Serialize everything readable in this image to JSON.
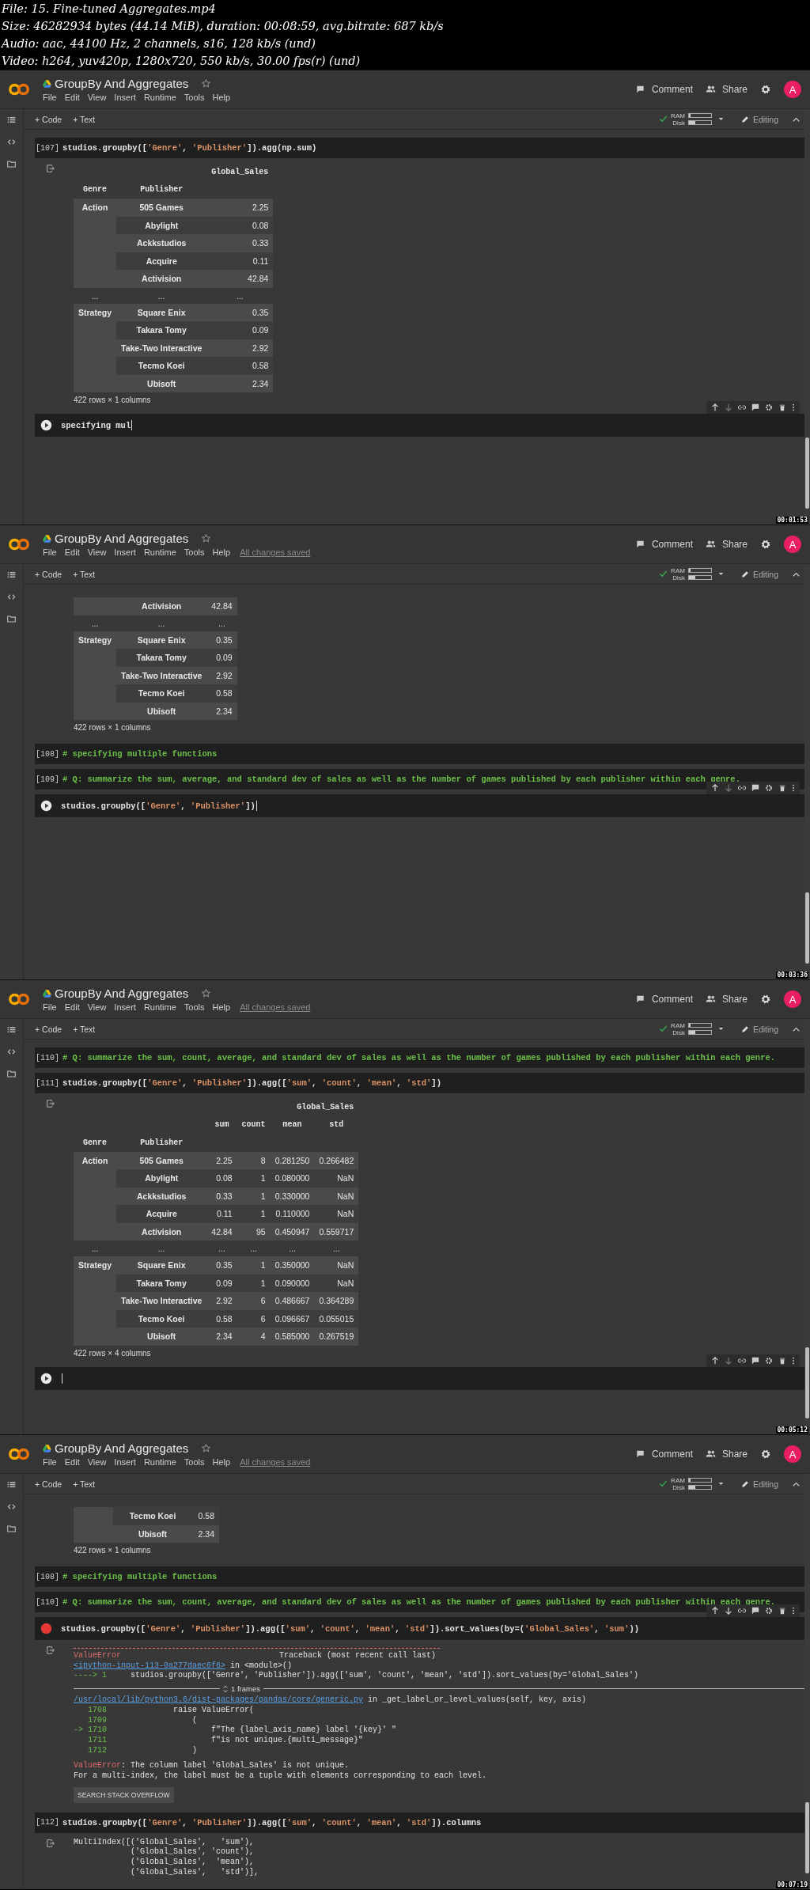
{
  "file_info": [
    "File: 15. Fine-tuned Aggregates.mp4",
    "Size: 46282934 bytes (44.14 MiB), duration: 00:08:59, avg.bitrate: 687 kb/s",
    "Audio: aac, 44100 Hz, 2 channels, s16, 128 kb/s (und)",
    "Video: h264, yuv420p, 1280x720, 550 kb/s, 30.00 fps(r) (und)"
  ],
  "frames": [
    {
      "title": "GroupBy And Aggregates",
      "menu": [
        "File",
        "Edit",
        "View",
        "Insert",
        "Runtime",
        "Tools",
        "Help"
      ],
      "comment": "Comment",
      "share": "Share",
      "avatar": "A",
      "add_code": "+ Code",
      "add_text": "+ Text",
      "ram": "RAM",
      "disk": "Disk",
      "mode": "Editing",
      "timestamp": "00:01:53",
      "cells": [
        {
          "kind": "code",
          "prompt": "[107]",
          "source": "studios.groupby(['Genre', 'Publisher']).agg(np.sum)",
          "output": {
            "kind": "table",
            "column_header": "Global_Sales",
            "index_names": [
              "Genre",
              "Publisher"
            ],
            "groups": [
              {
                "genre": "Action",
                "rows": [
                  {
                    "publisher": "505 Games",
                    "values": [
                      "2.25"
                    ]
                  },
                  {
                    "publisher": "Abylight",
                    "values": [
                      "0.08"
                    ]
                  },
                  {
                    "publisher": "Ackkstudios",
                    "values": [
                      "0.33"
                    ]
                  },
                  {
                    "publisher": "Acquire",
                    "values": [
                      "0.11"
                    ]
                  },
                  {
                    "publisher": "Activision",
                    "values": [
                      "42.84"
                    ]
                  }
                ]
              },
              {
                "ellipsis": [
                  "...",
                  "...",
                  "..."
                ]
              },
              {
                "genre": "Strategy",
                "rows": [
                  {
                    "publisher": "Square Enix",
                    "values": [
                      "0.35"
                    ]
                  },
                  {
                    "publisher": "Takara Tomy",
                    "values": [
                      "0.09"
                    ]
                  },
                  {
                    "publisher": "Take-Two Interactive",
                    "values": [
                      "2.92"
                    ]
                  },
                  {
                    "publisher": "Tecmo Koei",
                    "values": [
                      "0.58"
                    ]
                  },
                  {
                    "publisher": "Ubisoft",
                    "values": [
                      "2.34"
                    ]
                  }
                ]
              }
            ],
            "footer": "422 rows × 1 columns"
          }
        },
        {
          "kind": "active",
          "error": false,
          "source": "specifying mul"
        }
      ]
    },
    {
      "title": "GroupBy And Aggregates",
      "menu": [
        "File",
        "Edit",
        "View",
        "Insert",
        "Runtime",
        "Tools",
        "Help"
      ],
      "save_status": "All changes saved",
      "comment": "Comment",
      "share": "Share",
      "avatar": "A",
      "add_code": "+ Code",
      "add_text": "+ Text",
      "ram": "RAM",
      "disk": "Disk",
      "mode": "Editing",
      "timestamp": "00:03:36",
      "cells": [
        {
          "kind": "output",
          "output": {
            "kind": "table",
            "groups": [
              {
                "rows": [
                  {
                    "publisher": "Activision",
                    "values": [
                      "42.84"
                    ]
                  }
                ]
              },
              {
                "ellipsis": [
                  "...",
                  "...",
                  "..."
                ]
              },
              {
                "genre": "Strategy",
                "rows": [
                  {
                    "publisher": "Square Enix",
                    "values": [
                      "0.35"
                    ]
                  },
                  {
                    "publisher": "Takara Tomy",
                    "values": [
                      "0.09"
                    ]
                  },
                  {
                    "publisher": "Take-Two Interactive",
                    "values": [
                      "2.92"
                    ]
                  },
                  {
                    "publisher": "Tecmo Koei",
                    "values": [
                      "0.58"
                    ]
                  },
                  {
                    "publisher": "Ubisoft",
                    "values": [
                      "2.34"
                    ]
                  }
                ]
              }
            ],
            "footer": "422 rows × 1 columns"
          }
        },
        {
          "kind": "comment",
          "prompt": "[108]",
          "source": "# specifying multiple functions"
        },
        {
          "kind": "comment",
          "prompt": "[109]",
          "source": "# Q: summarize the sum, average, and standard dev of sales as well as the number of games published by each publisher within each genre."
        },
        {
          "kind": "active",
          "error": false,
          "source": "studios.groupby(['Genre', 'Publisher'])"
        }
      ]
    },
    {
      "title": "GroupBy And Aggregates",
      "menu": [
        "File",
        "Edit",
        "View",
        "Insert",
        "Runtime",
        "Tools",
        "Help"
      ],
      "save_status": "All changes saved",
      "comment": "Comment",
      "share": "Share",
      "avatar": "A",
      "add_code": "+ Code",
      "add_text": "+ Text",
      "ram": "RAM",
      "disk": "Disk",
      "mode": "Editing",
      "timestamp": "00:05:12",
      "cells": [
        {
          "kind": "comment",
          "prompt": "[110]",
          "source": "# Q: summarize the sum, count, average, and standard dev of sales as well as the number of games published by each publisher within each genre."
        },
        {
          "kind": "code",
          "prompt": "[111]",
          "source": "studios.groupby(['Genre', 'Publisher']).agg(['sum', 'count', 'mean', 'std'])",
          "output": {
            "kind": "table",
            "column_header": "Global_Sales",
            "subcolumns": [
              "sum",
              "count",
              "mean",
              "std"
            ],
            "index_names": [
              "Genre",
              "Publisher"
            ],
            "groups": [
              {
                "genre": "Action",
                "rows": [
                  {
                    "publisher": "505 Games",
                    "values": [
                      "2.25",
                      "8",
                      "0.281250",
                      "0.266482"
                    ]
                  },
                  {
                    "publisher": "Abylight",
                    "values": [
                      "0.08",
                      "1",
                      "0.080000",
                      "NaN"
                    ]
                  },
                  {
                    "publisher": "Ackkstudios",
                    "values": [
                      "0.33",
                      "1",
                      "0.330000",
                      "NaN"
                    ]
                  },
                  {
                    "publisher": "Acquire",
                    "values": [
                      "0.11",
                      "1",
                      "0.110000",
                      "NaN"
                    ]
                  },
                  {
                    "publisher": "Activision",
                    "values": [
                      "42.84",
                      "95",
                      "0.450947",
                      "0.559717"
                    ]
                  }
                ]
              },
              {
                "ellipsis": [
                  "...",
                  "...",
                  "...",
                  "...",
                  "...",
                  "..."
                ]
              },
              {
                "genre": "Strategy",
                "rows": [
                  {
                    "publisher": "Square Enix",
                    "values": [
                      "0.35",
                      "1",
                      "0.350000",
                      "NaN"
                    ]
                  },
                  {
                    "publisher": "Takara Tomy",
                    "values": [
                      "0.09",
                      "1",
                      "0.090000",
                      "NaN"
                    ]
                  },
                  {
                    "publisher": "Take-Two Interactive",
                    "values": [
                      "2.92",
                      "6",
                      "0.486667",
                      "0.364289"
                    ]
                  },
                  {
                    "publisher": "Tecmo Koei",
                    "values": [
                      "0.58",
                      "6",
                      "0.096667",
                      "0.055015"
                    ]
                  },
                  {
                    "publisher": "Ubisoft",
                    "values": [
                      "2.34",
                      "4",
                      "0.585000",
                      "0.267519"
                    ]
                  }
                ]
              }
            ],
            "footer": "422 rows × 4 columns"
          }
        },
        {
          "kind": "active",
          "error": false
        }
      ]
    },
    {
      "title": "GroupBy And Aggregates",
      "menu": [
        "File",
        "Edit",
        "View",
        "Insert",
        "Runtime",
        "Tools",
        "Help"
      ],
      "save_status": "All changes saved",
      "comment": "Comment",
      "share": "Share",
      "avatar": "A",
      "add_code": "+ Code",
      "add_text": "+ Text",
      "ram": "RAM",
      "disk": "Disk",
      "mode": "Editing",
      "timestamp": "00:07:19",
      "cells": [
        {
          "kind": "output",
          "output": {
            "kind": "table",
            "groups": [
              {
                "rows": [
                  {
                    "publisher": "Tecmo Koei",
                    "values": [
                      "0.58"
                    ]
                  },
                  {
                    "publisher": "Ubisoft",
                    "values": [
                      "2.34"
                    ]
                  }
                ]
              }
            ],
            "footer": "422 rows × 1 columns"
          }
        },
        {
          "kind": "comment",
          "prompt": "[108]",
          "source": "# specifying multiple functions"
        },
        {
          "kind": "comment",
          "prompt": "[110]",
          "source": "# Q: summarize the sum, count, average, and standard dev of sales as well as the number of games published by each publisher within each genre."
        },
        {
          "kind": "active",
          "error": true,
          "source": "studios.groupby(['Genre', 'Publisher']).agg(['sum', 'count', 'mean', 'std']).sort_values(by=('Global_Sales', 'sum'))",
          "output": {
            "kind": "traceback",
            "lines": [
              {
                "kind": "rule"
              },
              {
                "kind": "heading",
                "error": "ValueError",
                "text": "Traceback (most recent call last)"
              },
              {
                "kind": "location",
                "link": "<ipython-input-113-0a277daec6f6>",
                "text": " in <module>()"
              },
              {
                "kind": "source",
                "marker": "---->",
                "number": "1",
                "code": " studios.groupby(['Genre', 'Publisher']).agg(['sum', 'count', 'mean', 'std']).sort_values(by='Global_Sales')"
              },
              {
                "kind": "frames",
                "text": "1 frames"
              },
              {
                "kind": "location",
                "link": "/usr/local/lib/python3.6/dist-packages/pandas/core/generic.py",
                "text": " in _get_label_or_level_values(self, key, axis)"
              },
              {
                "kind": "source",
                "number": "1708",
                "code": "             raise ValueError("
              },
              {
                "kind": "source",
                "number": "1709",
                "code": "                 ("
              },
              {
                "kind": "source",
                "marker": "->",
                "number": "1710",
                "code": "                     f\"The {label_axis_name} label '{key}' \""
              },
              {
                "kind": "source",
                "number": "1711",
                "code": "                     f\"is not unique.{multi_message}\""
              },
              {
                "kind": "source",
                "number": "1712",
                "code": "                 )"
              },
              {
                "kind": "message",
                "error": "ValueError",
                "text": ": The column label 'Global_Sales' is not unique."
              },
              {
                "kind": "plain",
                "text": "For a multi-index, the label must be a tuple with elements corresponding to each level."
              },
              {
                "kind": "button",
                "text": "SEARCH STACK OVERFLOW"
              }
            ]
          }
        },
        {
          "kind": "code",
          "prompt": "[112]",
          "source": "studios.groupby(['Genre', 'Publisher']).agg(['sum', 'count', 'mean', 'std']).columns",
          "output": {
            "kind": "text",
            "lines": [
              "MultiIndex([('Global_Sales',   'sum'),",
              "            ('Global_Sales', 'count'),",
              "            ('Global_Sales',  'mean'),",
              "            ('Global_Sales',   'std')],"
            ]
          }
        }
      ]
    }
  ]
}
